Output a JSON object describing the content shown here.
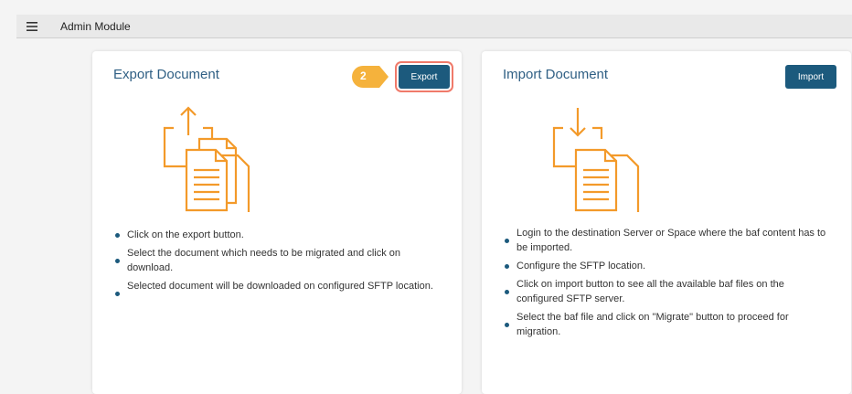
{
  "topbar": {
    "title": "Admin Module"
  },
  "export_card": {
    "title": "Export Document",
    "button_label": "Export",
    "step_number": "2",
    "steps": [
      "Click on the export button.",
      "Select the document which needs to be migrated and click on download.",
      "Selected document will be downloaded on configured SFTP location."
    ]
  },
  "import_card": {
    "title": "Import Document",
    "button_label": "Import",
    "steps": [
      "Login to the destination Server or Space where the baf content has to be imported.",
      "Configure the SFTP location.",
      "Click on import button to see all the available baf files on the configured SFTP server.",
      "Select the baf file and click on \"Migrate\" button to proceed for migration."
    ]
  },
  "colors": {
    "accent": "#1c5a7d",
    "title": "#2f5f84",
    "icon": "#f39a2a",
    "highlight": "#f07a6a",
    "badge": "#f5b23c"
  }
}
